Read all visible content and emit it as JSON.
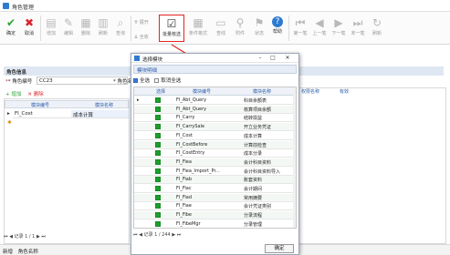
{
  "window": {
    "title": "角色管理"
  },
  "toolbar": {
    "save": "确定",
    "cancel": "取消",
    "add": "增加",
    "edit": "编辑",
    "delete": "删除",
    "refresh": "刷新",
    "query": "查询",
    "expand": "展开",
    "collapse": "全收",
    "batch_check": "批量核选",
    "condition_format": "条件格式",
    "print": "查线",
    "attachment": "附件",
    "status": "状态",
    "help": "帮助",
    "first": "第一笔",
    "prev": "上一笔",
    "next": "下一笔",
    "last": "末一笔",
    "reload": "刷新"
  },
  "role_info": {
    "header": "角色信息",
    "role_code_label": "* 角色编号",
    "role_code_value": "CC23",
    "role_name_label": "* 角色名"
  },
  "grid": {
    "add_label": "+ 增加",
    "delete_label": "✕ 删除",
    "col_module_code": "模块编号",
    "col_module_name": "模块名称",
    "rows": [
      {
        "code": "FI_Cost",
        "name": "成本计算"
      }
    ],
    "record": "记录 1 / 1"
  },
  "right_grid": {
    "col_permission": "权限名称",
    "col_valid": "有效"
  },
  "dialog": {
    "title": "选择模块",
    "tab_label": "模块明细",
    "select_all": "全选",
    "cancel_all": "取消全选",
    "col_select": "选择",
    "col_code": "模块编号",
    "col_name": "模块名称",
    "rows": [
      {
        "code": "FI_Abt_Query",
        "name": "科目余额表"
      },
      {
        "code": "FI_Abt_Query",
        "name": "核算项目余额"
      },
      {
        "code": "FI_Carry",
        "name": "结转损益"
      },
      {
        "code": "FI_CarrySale",
        "name": "开立业务凭证"
      },
      {
        "code": "FI_Cost",
        "name": "成本计算"
      },
      {
        "code": "FI_CostBefore",
        "name": "计算前检查"
      },
      {
        "code": "FI_CostEntry",
        "name": "成本分录"
      },
      {
        "code": "FI_Fiea",
        "name": "会计科目资料"
      },
      {
        "code": "FI_Fiea_Import_Pr...",
        "name": "会计科目资料导入"
      },
      {
        "code": "FI_Fiab",
        "name": "账套资料"
      },
      {
        "code": "FI_Fiac",
        "name": "会计期间"
      },
      {
        "code": "FI_Fiad",
        "name": "常用摘要"
      },
      {
        "code": "FI_Fiae",
        "name": "会计凭证类别"
      },
      {
        "code": "FI_Fibe",
        "name": "分录流程"
      },
      {
        "code": "FI_FibeMgr",
        "name": "分录管理"
      }
    ],
    "record": "记录 1 / 244",
    "ok": "确定"
  },
  "status_bar": {
    "left": "新增",
    "right": "角色名称"
  },
  "colors": {
    "accent": "#2d7bd0",
    "highlight_border": "#e52222",
    "check_green": "#1ca02c"
  }
}
